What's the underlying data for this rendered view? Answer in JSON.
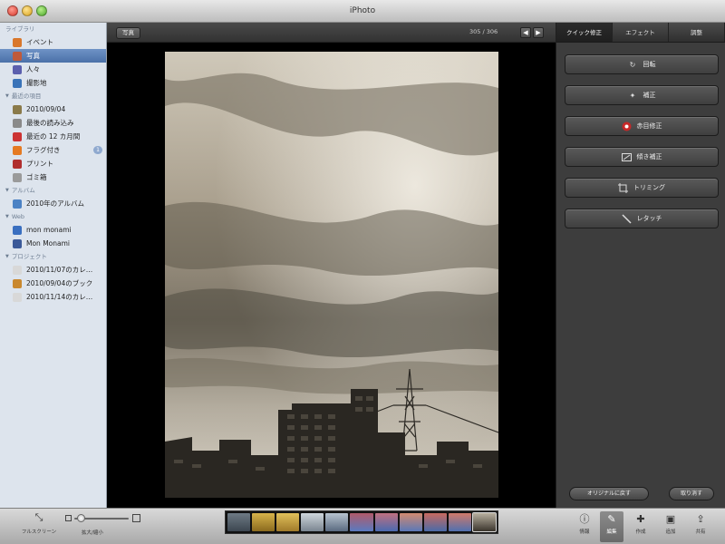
{
  "window": {
    "title": "iPhoto"
  },
  "sidebar": {
    "sections": [
      {
        "title": "ライブラリ",
        "items": [
          {
            "label": "イベント",
            "icon": "events-icon",
            "color": "#d9772b"
          },
          {
            "label": "写真",
            "icon": "photos-icon",
            "color": "#c05a3a",
            "selected": true
          },
          {
            "label": "人々",
            "icon": "faces-icon",
            "color": "#5b5fae"
          },
          {
            "label": "撮影地",
            "icon": "places-icon",
            "color": "#3a73b8"
          }
        ]
      },
      {
        "title": "最近の項目",
        "items": [
          {
            "label": "2010/09/04",
            "icon": "event-thumb-icon",
            "color": "#8a7a4a"
          },
          {
            "label": "最後の読み込み",
            "icon": "last-import-icon",
            "color": "#8a8a8a"
          },
          {
            "label": "最近の 12 カ月間",
            "icon": "calendar-icon",
            "color": "#c33"
          },
          {
            "label": "フラグ付き",
            "icon": "flag-icon",
            "color": "#e57a22",
            "badge": "1"
          },
          {
            "label": "プリント",
            "icon": "print-icon",
            "color": "#b02e2e"
          },
          {
            "label": "ゴミ箱",
            "icon": "trash-icon",
            "color": "#9a9a9a"
          }
        ]
      },
      {
        "title": "アルバム",
        "items": [
          {
            "label": "2010年のアルバム",
            "icon": "album-icon",
            "color": "#4b82c4"
          }
        ]
      },
      {
        "title": "Web",
        "items": [
          {
            "label": "mon monami",
            "icon": "web-album-icon",
            "color": "#3a6fc0"
          },
          {
            "label": "Mon Monami",
            "icon": "facebook-icon",
            "color": "#3b5998"
          }
        ]
      },
      {
        "title": "プロジェクト",
        "items": [
          {
            "label": "2010/11/07のカレ…",
            "icon": "calendar-project-icon",
            "color": "#d8d8d8"
          },
          {
            "label": "2010/09/04のブック",
            "icon": "book-project-icon",
            "color": "#c9882e"
          },
          {
            "label": "2010/11/14のカレ…",
            "icon": "calendar-project-icon",
            "color": "#d8d8d8"
          }
        ]
      }
    ]
  },
  "viewer": {
    "back_label": "写真",
    "counter": "305 / 306"
  },
  "edit_panel": {
    "tabs": [
      {
        "label": "クイック修正",
        "active": true
      },
      {
        "label": "エフェクト",
        "active": false
      },
      {
        "label": "調整",
        "active": false
      }
    ],
    "buttons": [
      {
        "label": "回転",
        "icon": "rotate-icon"
      },
      {
        "label": "補正",
        "icon": "enhance-icon"
      },
      {
        "label": "赤目修正",
        "icon": "red-eye-icon"
      },
      {
        "label": "傾き補正",
        "icon": "straighten-icon"
      },
      {
        "label": "トリミング",
        "icon": "crop-icon"
      },
      {
        "label": "レタッチ",
        "icon": "retouch-icon"
      }
    ],
    "revert_label": "オリジナルに戻す",
    "undo_label": "取り消す"
  },
  "bottom_bar": {
    "fullscreen_label": "フルスクリーン",
    "zoom_label": "拡大/縮小",
    "zoom_level": 0.08,
    "tools": [
      {
        "label": "情報",
        "icon": "info-icon"
      },
      {
        "label": "編集",
        "icon": "edit-pencil-icon",
        "active": true
      },
      {
        "label": "作成",
        "icon": "create-icon"
      },
      {
        "label": "追加",
        "icon": "add-to-icon"
      },
      {
        "label": "共有",
        "icon": "share-icon"
      }
    ]
  },
  "colors": {
    "sidebar_bg": "#dde4ed",
    "selection": "#4a70a8",
    "panel_bg": "#3d3d3d"
  }
}
